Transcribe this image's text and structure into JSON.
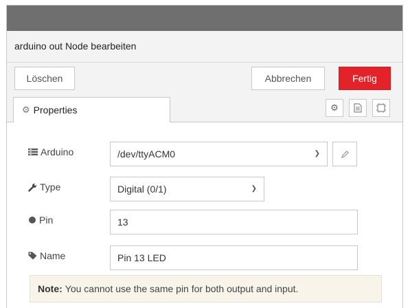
{
  "dialog": {
    "title": "arduino out Node bearbeiten"
  },
  "buttons": {
    "delete": "Löschen",
    "cancel": "Abbrechen",
    "done": "Fertig"
  },
  "tabs": {
    "properties_label": "Properties"
  },
  "form": {
    "arduino": {
      "label": "Arduino",
      "value": "/dev/ttyACM0"
    },
    "type": {
      "label": "Type",
      "value": "Digital (0/1)"
    },
    "pin": {
      "label": "Pin",
      "value": "13"
    },
    "name": {
      "label": "Name",
      "value": "Pin 13 LED"
    }
  },
  "note": {
    "label": "Note:",
    "text": "You cannot use the same pin for both output and input."
  },
  "colors": {
    "primary_button": "#e2242a",
    "top_bar": "#6f6f6f",
    "note_background": "#f8f4ea"
  },
  "icons": [
    "gear-icon",
    "settings-gear-icon",
    "description-icon",
    "appearance-icon",
    "serial-port-icon",
    "pencil-icon",
    "wrench-icon",
    "circle-icon",
    "tag-icon",
    "chevron-down-icon"
  ]
}
